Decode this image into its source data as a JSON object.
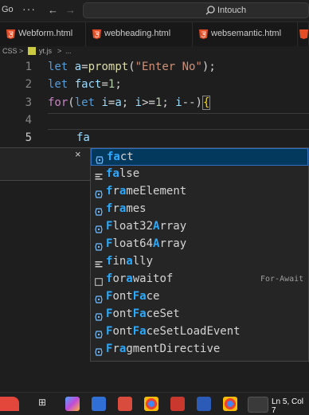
{
  "titlebar": {
    "menu_label": "Go",
    "more_label": "···",
    "back_label": "←",
    "forward_label": "→",
    "search_text": "Intouch"
  },
  "tabs": [
    {
      "label": "Webform.html"
    },
    {
      "label": "webheading.html"
    },
    {
      "label": "websemantic.html"
    },
    {
      "label": ""
    }
  ],
  "breadcrumb": {
    "root": "CSS",
    "sep1": ">",
    "file": "yt.js",
    "sep2": ">",
    "more": "..."
  },
  "lines": [
    {
      "number": "1"
    },
    {
      "number": "2"
    },
    {
      "number": "3"
    },
    {
      "number": "4"
    },
    {
      "number": "5"
    }
  ],
  "code": {
    "line1": {
      "kw": "let",
      "var": "a",
      "eq": "=",
      "fn": "prompt",
      "open": "(",
      "str": "\"Enter No\"",
      "close": ");"
    },
    "line2": {
      "kw": "let",
      "var": "fact",
      "eq": "=",
      "num": "1",
      "end": ";"
    },
    "line3": {
      "kw": "for",
      "open": "(",
      "kw2": "let",
      "rest1": " ",
      "var1": "i",
      "eq": "=",
      "var2": "a",
      "semi1": "; ",
      "var3": "i",
      "cmp": ">=",
      "num": "1",
      "semi2": "; ",
      "var4": "i",
      "dec": "--",
      "close": ")",
      "brace": "{"
    },
    "line5": {
      "typed": "fa"
    }
  },
  "suggest": {
    "close_label": "×",
    "items": [
      {
        "pre": "",
        "match": "fa",
        "rest": "ct",
        "detail": "",
        "icon": "variable-icon"
      },
      {
        "pre": "",
        "match": "fa",
        "rest": "lse",
        "detail": "",
        "icon": "keyword-icon"
      },
      {
        "pre": "",
        "match": "f",
        "rest": "r",
        "match2": "a",
        "rest2": "meElement",
        "detail": "",
        "icon": "variable-icon"
      },
      {
        "pre": "",
        "match": "f",
        "rest": "r",
        "match2": "a",
        "rest2": "mes",
        "detail": "",
        "icon": "variable-icon"
      },
      {
        "pre": "",
        "match": "F",
        "rest": "loat32",
        "match2": "A",
        "rest2": "rray",
        "detail": "",
        "icon": "variable-icon"
      },
      {
        "pre": "",
        "match": "F",
        "rest": "loat64",
        "match2": "A",
        "rest2": "rray",
        "detail": "",
        "icon": "variable-icon"
      },
      {
        "pre": "",
        "match": "f",
        "rest": "in",
        "match2": "a",
        "rest2": "lly",
        "detail": "",
        "icon": "keyword-icon"
      },
      {
        "pre": "",
        "match": "f",
        "rest": "or",
        "match2": "a",
        "rest2": "waitof",
        "detail": "For-Await",
        "icon": "snippet-icon"
      },
      {
        "pre": "",
        "match": "F",
        "rest": "ont",
        "match2": "Fa",
        "rest2": "ce",
        "detail": "",
        "icon": "variable-icon"
      },
      {
        "pre": "",
        "match": "F",
        "rest": "ont",
        "match2": "Fa",
        "rest2": "ceSet",
        "detail": "",
        "icon": "variable-icon"
      },
      {
        "pre": "",
        "match": "F",
        "rest": "ont",
        "match2": "Fa",
        "rest2": "ceSetLoadEvent",
        "detail": "",
        "icon": "variable-icon"
      },
      {
        "pre": "",
        "match": "F",
        "rest": "r",
        "match2": "a",
        "rest2": "gmentDirective",
        "detail": "",
        "icon": "variable-icon"
      }
    ]
  },
  "statusbar": {
    "position": "Ln 5, Col 7"
  },
  "colors": {
    "match": "#2aaaff",
    "selection": "#04395e",
    "html_icon": "#e44d26"
  }
}
